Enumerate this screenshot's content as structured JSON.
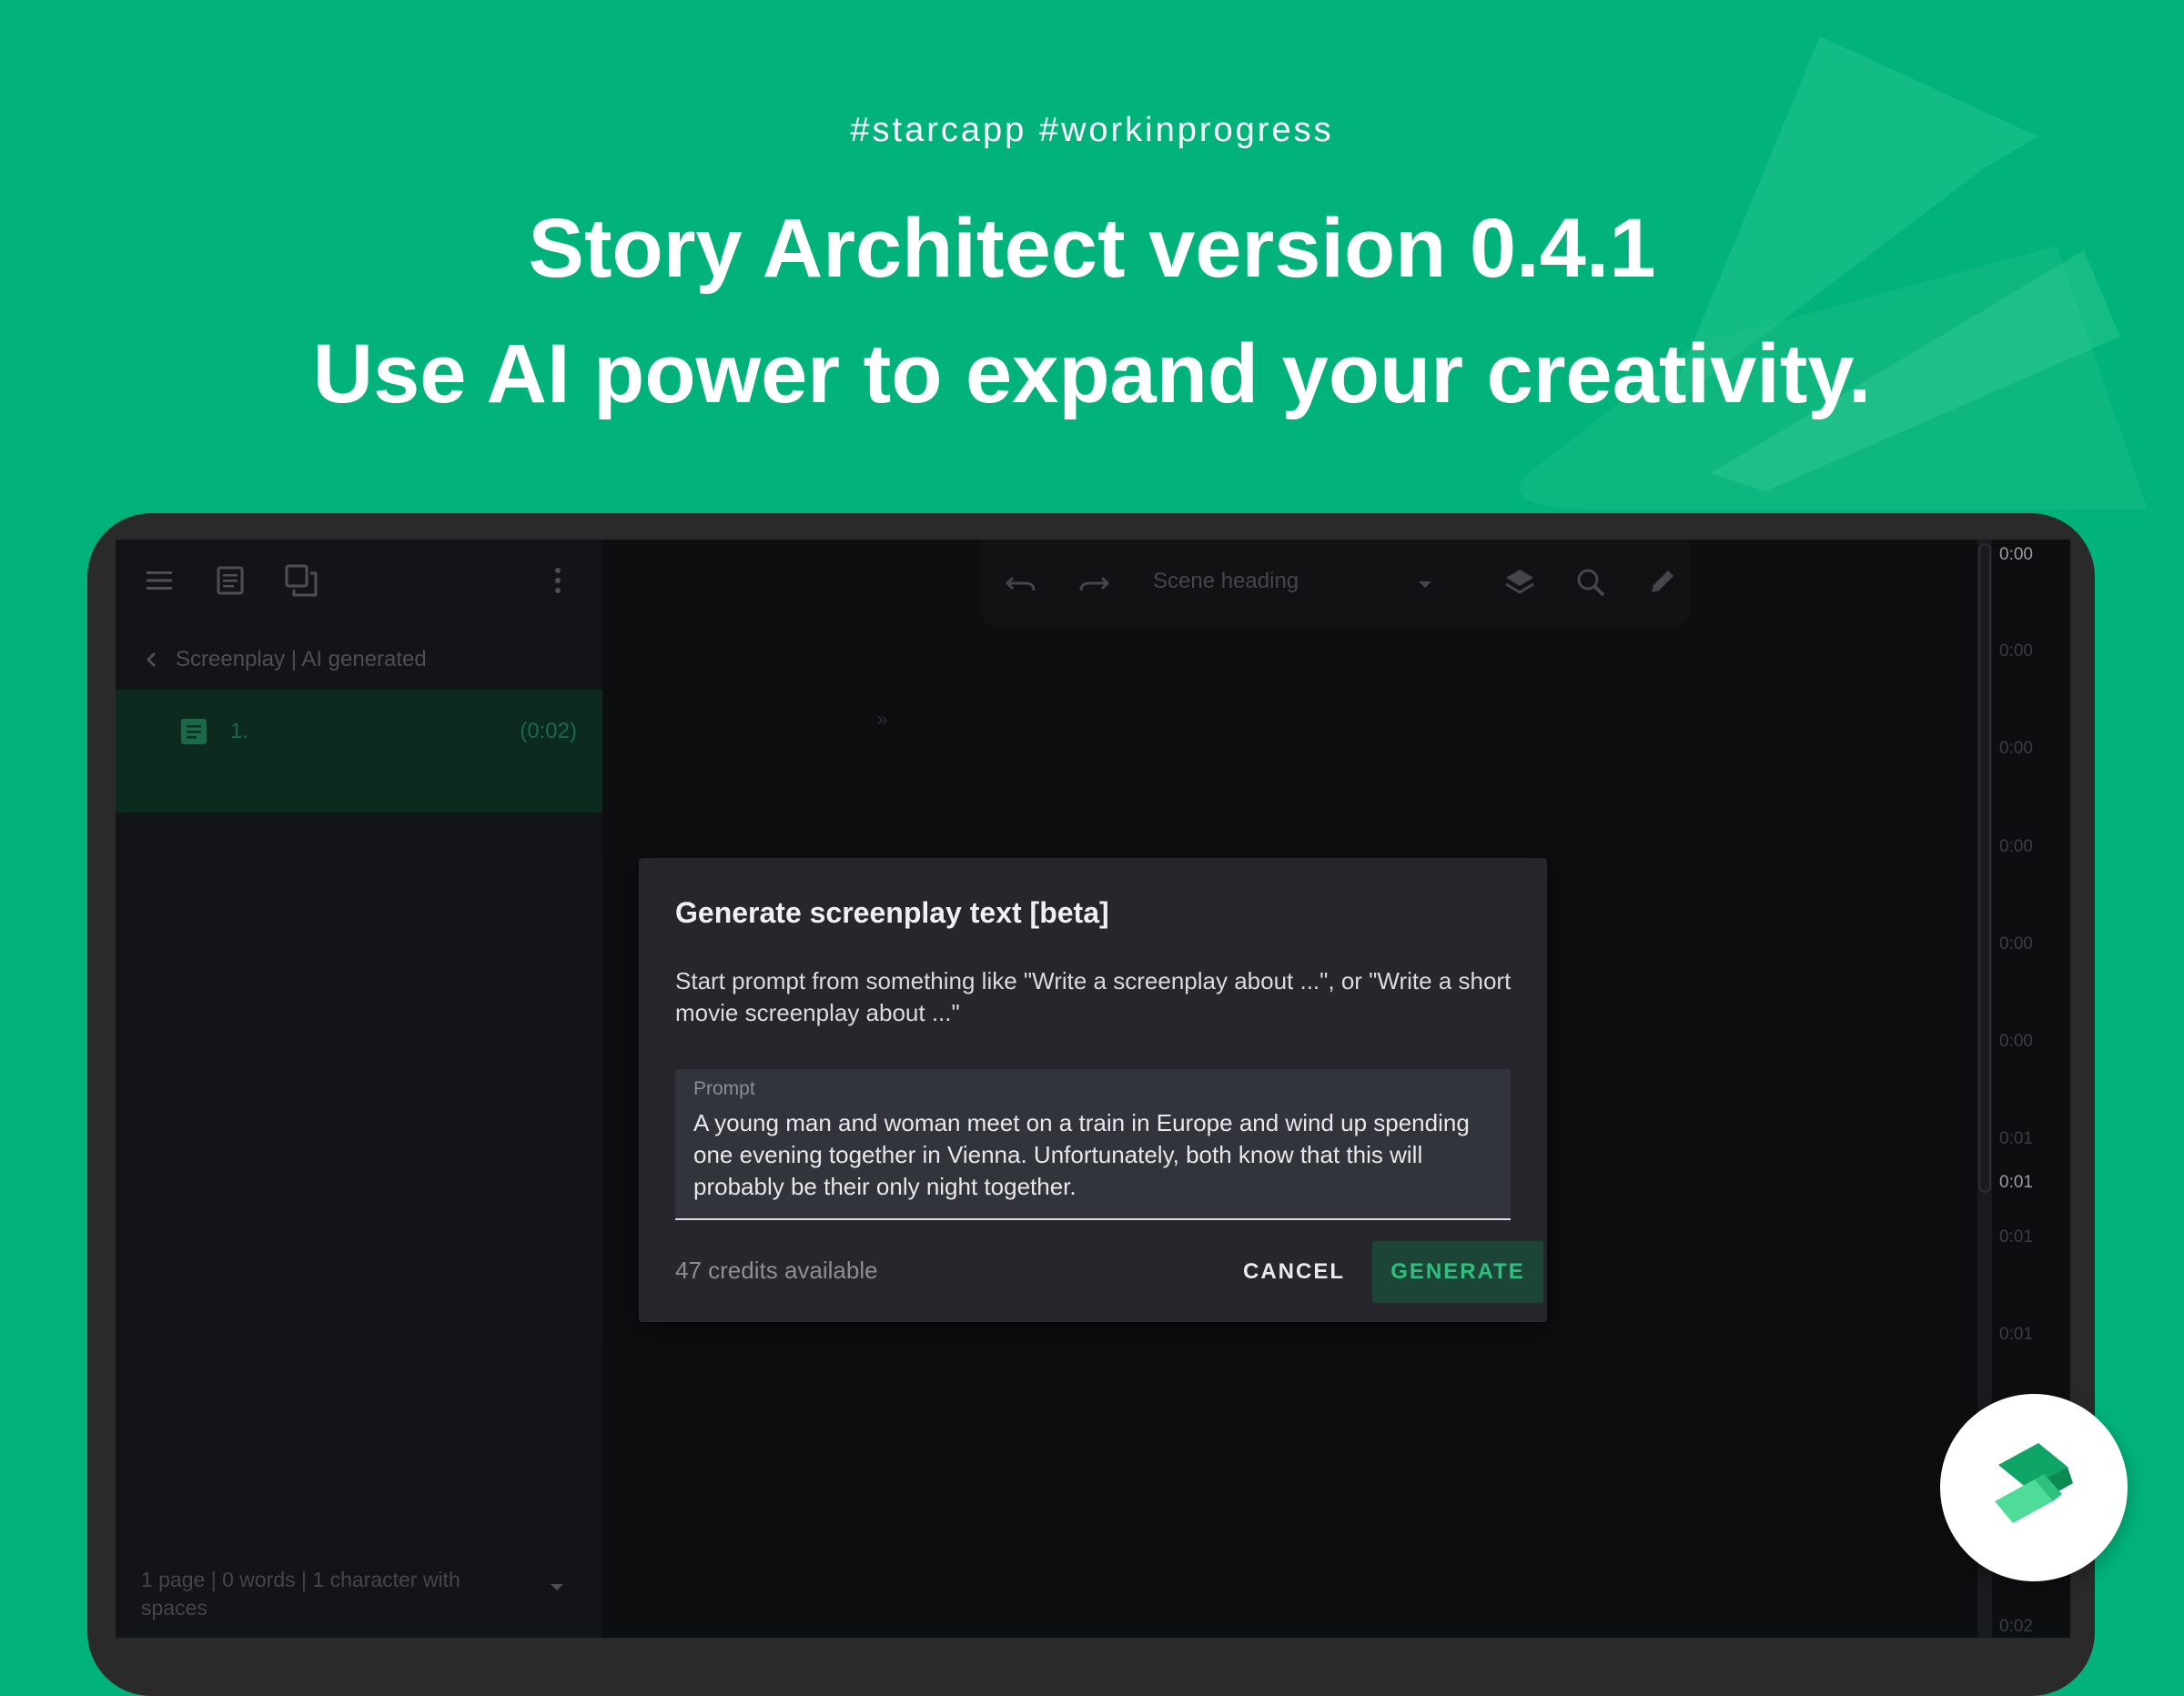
{
  "promo": {
    "hashtags": "#starcapp  #workinprogress",
    "headline_line1": "Story Architect version 0.4.1",
    "headline_line2": "Use AI power to expand your creativity."
  },
  "colors": {
    "background": "#01b37a",
    "accent": "#2fbf7e",
    "modal_bg": "#25272c",
    "screen_bg": "#0d0e10"
  },
  "sidebar": {
    "icons": [
      "menu-icon",
      "document-icon",
      "copy-windows-icon",
      "more-vertical-icon"
    ],
    "breadcrumb": "Screenplay | AI generated",
    "scene": {
      "number": "1.",
      "duration": "(0:02)"
    },
    "stats": "1 page | 0 words | 1 character with spaces"
  },
  "toolbar": {
    "icons": [
      "undo-icon",
      "redo-icon",
      "layers-icon",
      "search-icon",
      "pen-icon"
    ],
    "paragraph_type": "Scene heading"
  },
  "editor": {
    "marker": "»"
  },
  "timeline": {
    "ticks": [
      "0:00",
      "0:00",
      "0:00",
      "0:00",
      "0:00",
      "0:00",
      "0:01",
      "0:01",
      "0:01",
      "0:01",
      "0:02"
    ]
  },
  "dialog": {
    "title": "Generate screenplay text [beta]",
    "description": "Start prompt from something like \"Write a screenplay about ...\", or \"Write a short movie screenplay about ...\"",
    "prompt_label": "Prompt",
    "prompt_value": "A young man and woman meet on a train in Europe and wind up spending one evening together in Vienna. Unfortunately, both know that this will probably be their only night together.",
    "credits": "47 credits available",
    "cancel_label": "CANCEL",
    "generate_label": "GENERATE"
  }
}
